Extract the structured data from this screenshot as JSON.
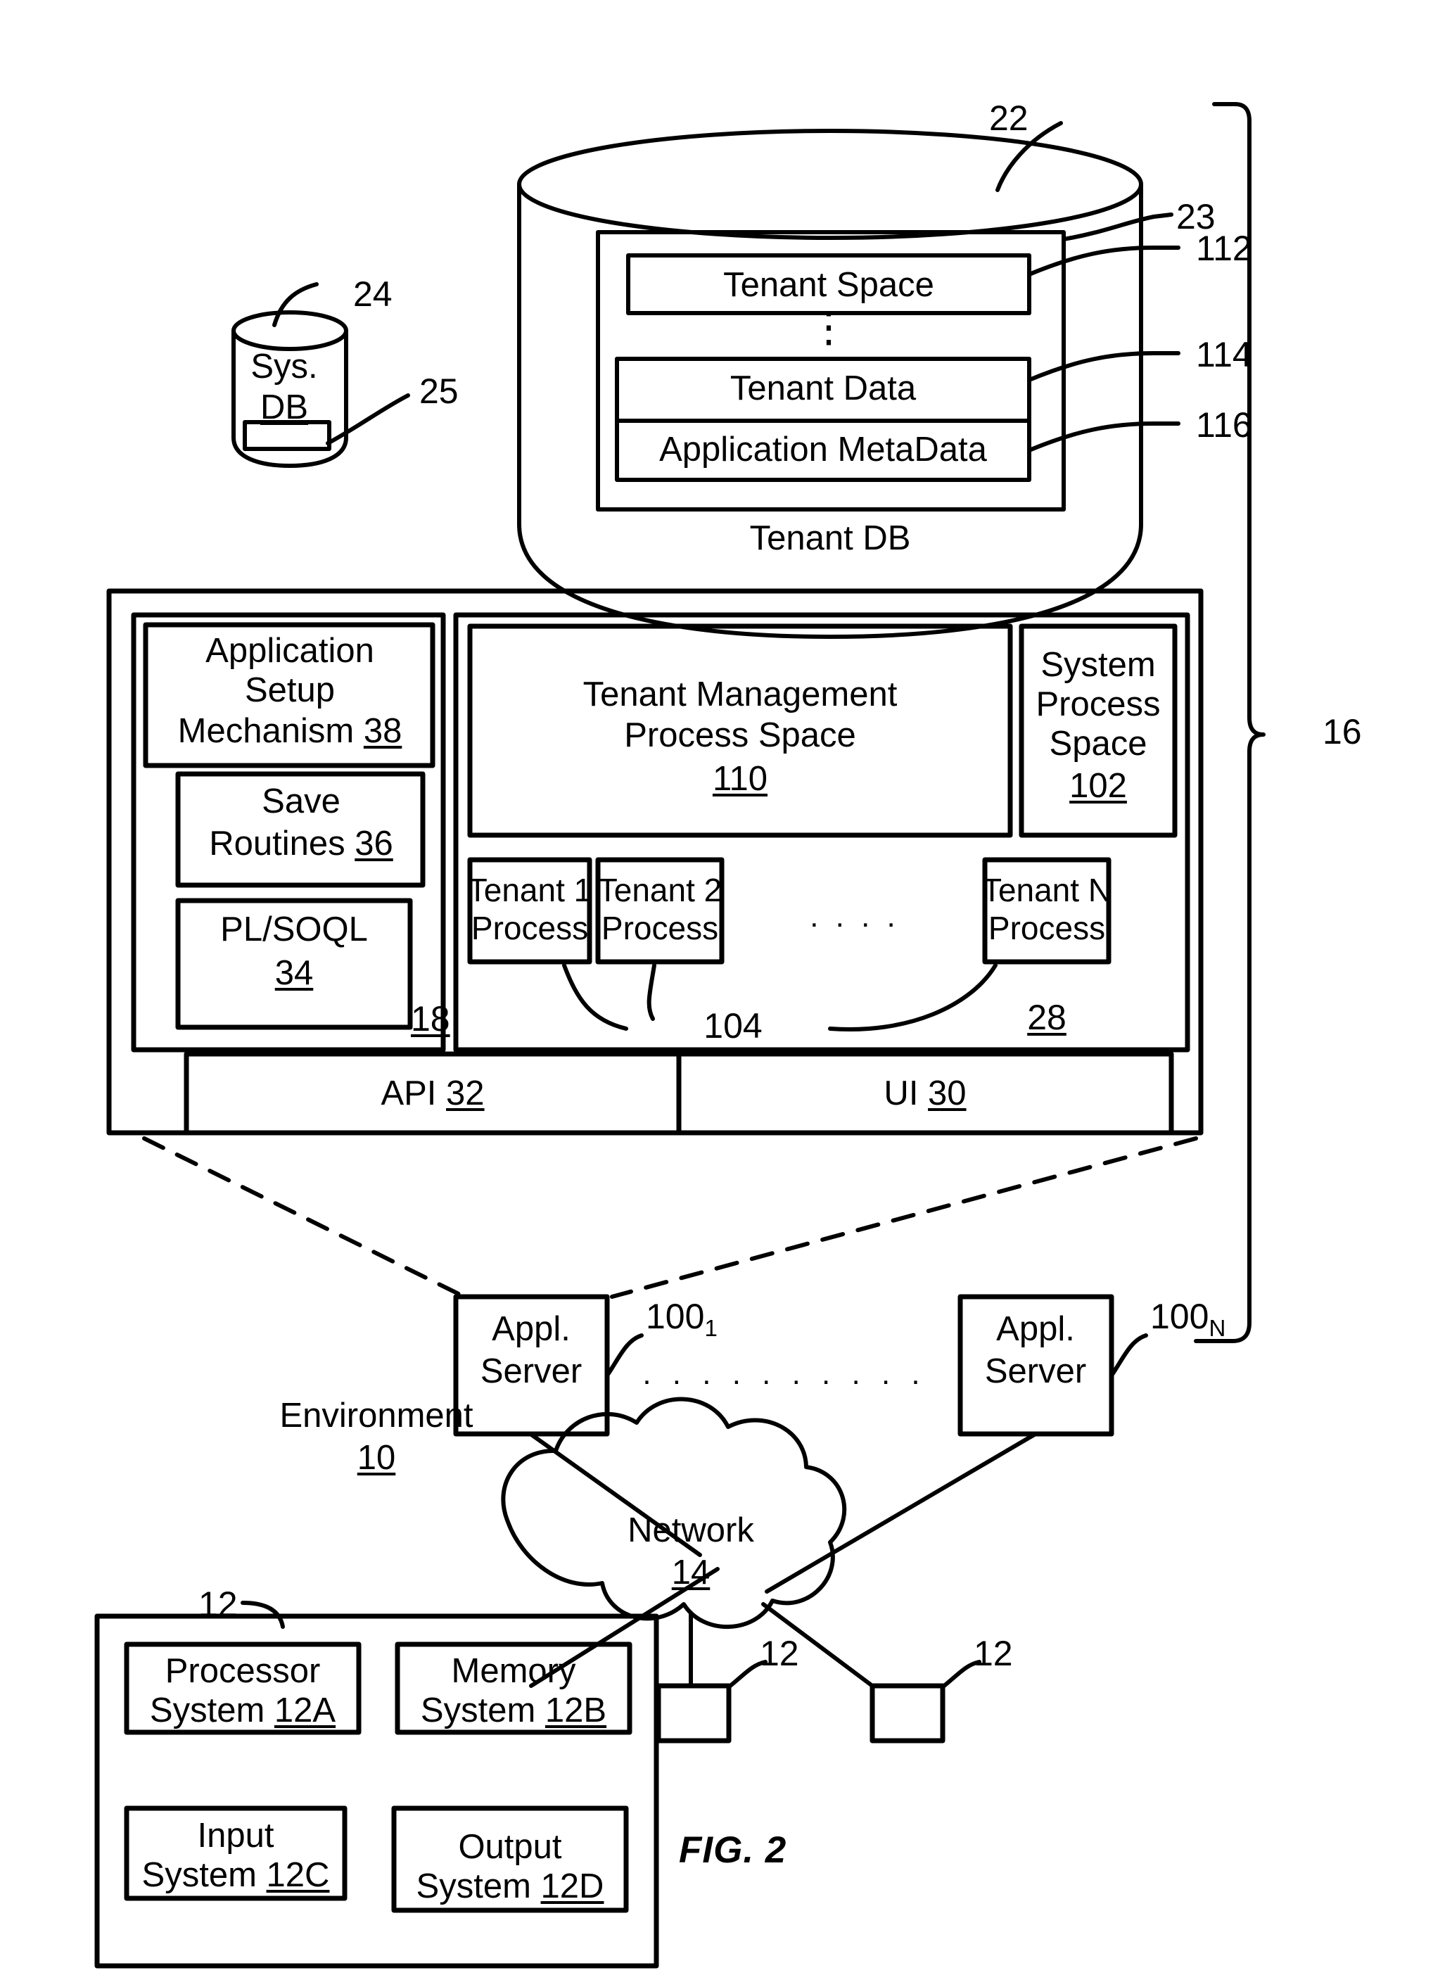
{
  "figure": {
    "caption": "FIG. 2",
    "environment_label": "Environment",
    "environment_ref": "10"
  },
  "tenant_db": {
    "title": "Tenant DB",
    "ref": "22",
    "inner_container_ref": "23",
    "ellipsis": "⋮",
    "rows": [
      {
        "label": "Tenant Space",
        "ref": "112"
      },
      {
        "label": "Tenant Data",
        "ref": "114"
      },
      {
        "label": "Application MetaData",
        "ref": "116"
      }
    ]
  },
  "sys_db": {
    "line1": "Sys.",
    "line2": "DB",
    "ref": "24",
    "index_ref": "25"
  },
  "system": {
    "bracket_ref": "16",
    "app_platform_ref": "18",
    "process_space_ref": "28"
  },
  "app_setup": {
    "mechanism": {
      "line1": "Application",
      "line2": "Setup",
      "line3": "Mechanism",
      "ref": "38"
    },
    "save_routines": {
      "line1": "Save",
      "line2": "Routines",
      "ref": "36"
    },
    "plsoql": {
      "line1": "PL/SOQL",
      "ref": "34"
    }
  },
  "process_spaces": {
    "tenant_management": {
      "line1": "Tenant Management",
      "line2": "Process Space",
      "ref": "110"
    },
    "system_process": {
      "line1": "System",
      "line2": "Process",
      "line3": "Space",
      "ref": "102"
    }
  },
  "tenant_processes": {
    "items": [
      {
        "line1": "Tenant 1",
        "line2": "Process"
      },
      {
        "line1": "Tenant 2",
        "line2": "Process"
      },
      {
        "line1": "Tenant N",
        "line2": "Process"
      }
    ],
    "ellipsis": ". . . .",
    "ref": "104"
  },
  "interfaces": {
    "api": {
      "label": "API",
      "ref": "32"
    },
    "ui": {
      "label": "UI",
      "ref": "30"
    }
  },
  "app_servers": {
    "first": {
      "line1": "Appl.",
      "line2": "Server",
      "ref": "100",
      "ref_sub": "1"
    },
    "last": {
      "line1": "Appl.",
      "line2": "Server",
      "ref": "100",
      "ref_sub": "N"
    },
    "ellipsis": ". . . . . . . . . ."
  },
  "network": {
    "label": "Network",
    "ref": "14"
  },
  "user_system": {
    "ref": "12",
    "blocks": [
      {
        "line1": "Processor",
        "line2": "System",
        "ref": "12A"
      },
      {
        "line1": "Memory",
        "line2": "System",
        "ref": "12B"
      },
      {
        "line1": "Input",
        "line2": "System",
        "ref": "12C"
      },
      {
        "line1": "Output",
        "line2": "System",
        "ref": "12D"
      }
    ]
  },
  "other_user_systems": [
    {
      "ref": "12"
    },
    {
      "ref": "12"
    }
  ]
}
